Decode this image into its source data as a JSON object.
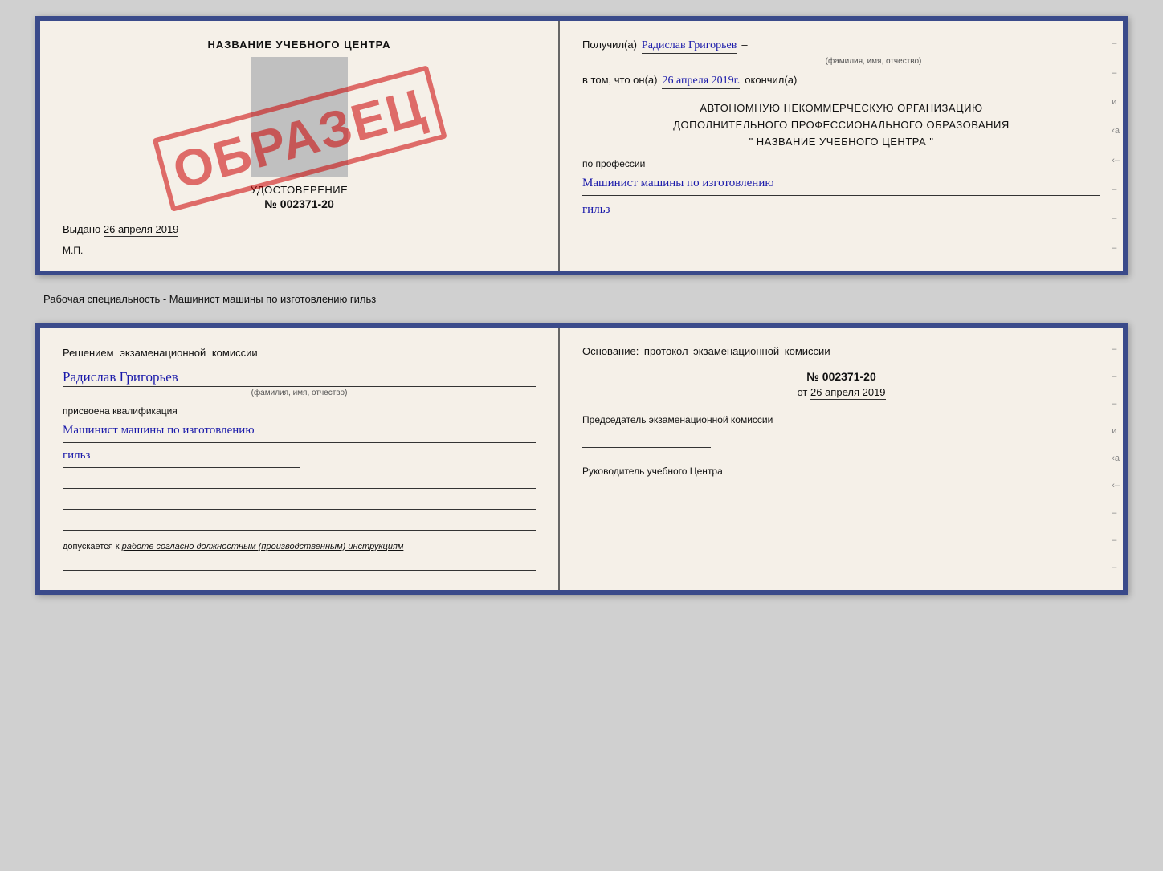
{
  "top_doc": {
    "left": {
      "title": "НАЗВАНИЕ УЧЕБНОГО ЦЕНТРА",
      "cert_label": "УДОСТОВЕРЕНИЕ",
      "cert_number": "№ 002371-20",
      "issued_label": "Выдано",
      "issued_date": "26 апреля 2019",
      "mp_label": "М.П.",
      "stamp_text": "ОБРАЗЕЦ"
    },
    "right": {
      "received_label": "Получил(а)",
      "name_handwritten": "Радислав Григорьев",
      "name_sublabel": "(фамилия, имя, отчество)",
      "in_that_label": "в том, что он(а)",
      "date_handwritten": "26 апреля 2019г.",
      "finished_label": "окончил(а)",
      "org_line1": "АВТОНОМНУЮ НЕКОММЕРЧЕСКУЮ ОРГАНИЗАЦИЮ",
      "org_line2": "ДОПОЛНИТЕЛЬНОГО ПРОФЕССИОНАЛЬНОГО ОБРАЗОВАНИЯ",
      "org_line3": "\"  НАЗВАНИЕ УЧЕБНОГО ЦЕНТРА  \"",
      "profession_label": "по профессии",
      "profession_handwritten1": "Машинист машины по изготовлению",
      "profession_handwritten2": "гильз"
    }
  },
  "working_spec": {
    "text": "Рабочая специальность - Машинист машины по изготовлению гильз"
  },
  "bottom_doc": {
    "left": {
      "decision_text": "Решением  экзаменационной  комиссии",
      "name_handwritten": "Радислав Григорьев",
      "name_sublabel": "(фамилия, имя, отчество)",
      "qual_assigned_label": "присвоена квалификация",
      "qual_handwritten1": "Машинист  машины  по  изготовлению",
      "qual_handwritten2": "гильз",
      "допуск_label": "допускается к",
      "допуск_italic": "работе согласно должностным (производственным) инструкциям"
    },
    "right": {
      "osnov_text": "Основание: протокол экзаменационной  комиссии",
      "proto_number": "№  002371-20",
      "proto_date_prefix": "от",
      "proto_date": "26 апреля 2019",
      "chairman_label": "Председатель экзаменационной комиссии",
      "head_label": "Руководитель учебного Центра"
    }
  },
  "spine_markers": [
    "–",
    "–",
    "и",
    "‹а",
    "‹–",
    "–",
    "–",
    "–"
  ],
  "spine_markers_bottom": [
    "–",
    "–",
    "–",
    "и",
    "‹а",
    "‹–",
    "–",
    "–",
    "–"
  ]
}
